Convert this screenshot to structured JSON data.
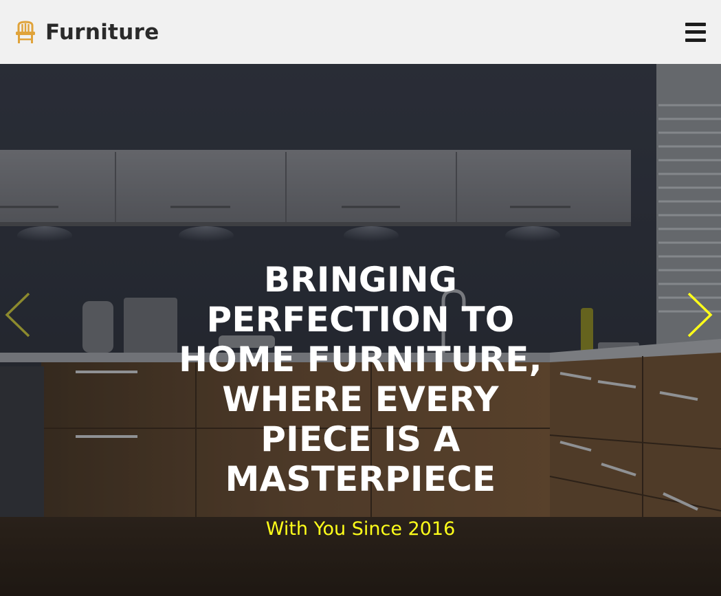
{
  "header": {
    "brand_name": "Furniture",
    "brand_icon": "chair-icon",
    "menu_icon": "hamburger-menu-icon"
  },
  "hero": {
    "headline": "BRINGING PERFECTION TO HOME FURNITURE, WHERE EVERY PIECE IS A MASTERPIECE",
    "tagline": "With You Since 2016",
    "prev_icon": "chevron-left-icon",
    "next_icon": "chevron-right-icon"
  },
  "colors": {
    "header_bg": "#f1f1f1",
    "brand_icon": "#e0a33a",
    "tagline": "#ffff1a",
    "next_arrow": "#ffff1a",
    "prev_arrow": "#8c8a2e"
  }
}
